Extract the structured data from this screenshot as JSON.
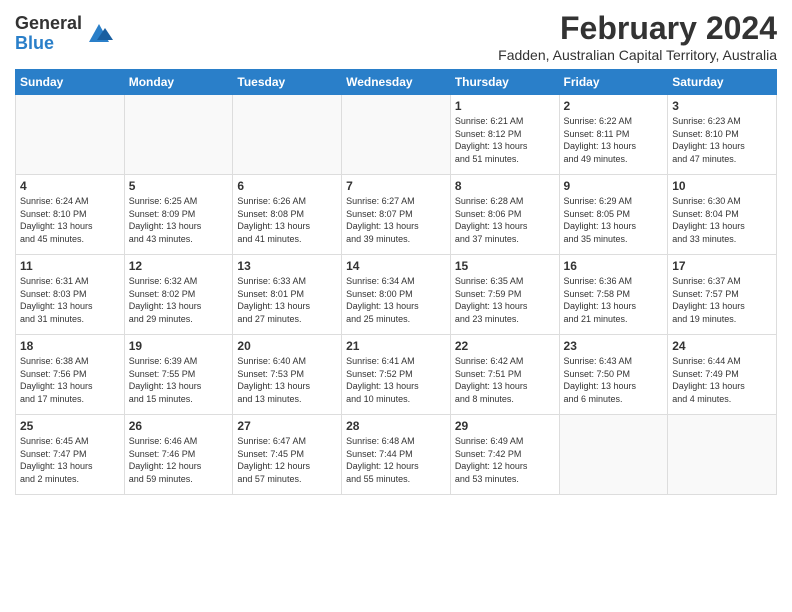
{
  "logo": {
    "line1": "General",
    "line2": "Blue"
  },
  "title": "February 2024",
  "location": "Fadden, Australian Capital Territory, Australia",
  "days_of_week": [
    "Sunday",
    "Monday",
    "Tuesday",
    "Wednesday",
    "Thursday",
    "Friday",
    "Saturday"
  ],
  "weeks": [
    [
      {
        "day": "",
        "info": ""
      },
      {
        "day": "",
        "info": ""
      },
      {
        "day": "",
        "info": ""
      },
      {
        "day": "",
        "info": ""
      },
      {
        "day": "1",
        "info": "Sunrise: 6:21 AM\nSunset: 8:12 PM\nDaylight: 13 hours\nand 51 minutes."
      },
      {
        "day": "2",
        "info": "Sunrise: 6:22 AM\nSunset: 8:11 PM\nDaylight: 13 hours\nand 49 minutes."
      },
      {
        "day": "3",
        "info": "Sunrise: 6:23 AM\nSunset: 8:10 PM\nDaylight: 13 hours\nand 47 minutes."
      }
    ],
    [
      {
        "day": "4",
        "info": "Sunrise: 6:24 AM\nSunset: 8:10 PM\nDaylight: 13 hours\nand 45 minutes."
      },
      {
        "day": "5",
        "info": "Sunrise: 6:25 AM\nSunset: 8:09 PM\nDaylight: 13 hours\nand 43 minutes."
      },
      {
        "day": "6",
        "info": "Sunrise: 6:26 AM\nSunset: 8:08 PM\nDaylight: 13 hours\nand 41 minutes."
      },
      {
        "day": "7",
        "info": "Sunrise: 6:27 AM\nSunset: 8:07 PM\nDaylight: 13 hours\nand 39 minutes."
      },
      {
        "day": "8",
        "info": "Sunrise: 6:28 AM\nSunset: 8:06 PM\nDaylight: 13 hours\nand 37 minutes."
      },
      {
        "day": "9",
        "info": "Sunrise: 6:29 AM\nSunset: 8:05 PM\nDaylight: 13 hours\nand 35 minutes."
      },
      {
        "day": "10",
        "info": "Sunrise: 6:30 AM\nSunset: 8:04 PM\nDaylight: 13 hours\nand 33 minutes."
      }
    ],
    [
      {
        "day": "11",
        "info": "Sunrise: 6:31 AM\nSunset: 8:03 PM\nDaylight: 13 hours\nand 31 minutes."
      },
      {
        "day": "12",
        "info": "Sunrise: 6:32 AM\nSunset: 8:02 PM\nDaylight: 13 hours\nand 29 minutes."
      },
      {
        "day": "13",
        "info": "Sunrise: 6:33 AM\nSunset: 8:01 PM\nDaylight: 13 hours\nand 27 minutes."
      },
      {
        "day": "14",
        "info": "Sunrise: 6:34 AM\nSunset: 8:00 PM\nDaylight: 13 hours\nand 25 minutes."
      },
      {
        "day": "15",
        "info": "Sunrise: 6:35 AM\nSunset: 7:59 PM\nDaylight: 13 hours\nand 23 minutes."
      },
      {
        "day": "16",
        "info": "Sunrise: 6:36 AM\nSunset: 7:58 PM\nDaylight: 13 hours\nand 21 minutes."
      },
      {
        "day": "17",
        "info": "Sunrise: 6:37 AM\nSunset: 7:57 PM\nDaylight: 13 hours\nand 19 minutes."
      }
    ],
    [
      {
        "day": "18",
        "info": "Sunrise: 6:38 AM\nSunset: 7:56 PM\nDaylight: 13 hours\nand 17 minutes."
      },
      {
        "day": "19",
        "info": "Sunrise: 6:39 AM\nSunset: 7:55 PM\nDaylight: 13 hours\nand 15 minutes."
      },
      {
        "day": "20",
        "info": "Sunrise: 6:40 AM\nSunset: 7:53 PM\nDaylight: 13 hours\nand 13 minutes."
      },
      {
        "day": "21",
        "info": "Sunrise: 6:41 AM\nSunset: 7:52 PM\nDaylight: 13 hours\nand 10 minutes."
      },
      {
        "day": "22",
        "info": "Sunrise: 6:42 AM\nSunset: 7:51 PM\nDaylight: 13 hours\nand 8 minutes."
      },
      {
        "day": "23",
        "info": "Sunrise: 6:43 AM\nSunset: 7:50 PM\nDaylight: 13 hours\nand 6 minutes."
      },
      {
        "day": "24",
        "info": "Sunrise: 6:44 AM\nSunset: 7:49 PM\nDaylight: 13 hours\nand 4 minutes."
      }
    ],
    [
      {
        "day": "25",
        "info": "Sunrise: 6:45 AM\nSunset: 7:47 PM\nDaylight: 13 hours\nand 2 minutes."
      },
      {
        "day": "26",
        "info": "Sunrise: 6:46 AM\nSunset: 7:46 PM\nDaylight: 12 hours\nand 59 minutes."
      },
      {
        "day": "27",
        "info": "Sunrise: 6:47 AM\nSunset: 7:45 PM\nDaylight: 12 hours\nand 57 minutes."
      },
      {
        "day": "28",
        "info": "Sunrise: 6:48 AM\nSunset: 7:44 PM\nDaylight: 12 hours\nand 55 minutes."
      },
      {
        "day": "29",
        "info": "Sunrise: 6:49 AM\nSunset: 7:42 PM\nDaylight: 12 hours\nand 53 minutes."
      },
      {
        "day": "",
        "info": ""
      },
      {
        "day": "",
        "info": ""
      }
    ]
  ]
}
